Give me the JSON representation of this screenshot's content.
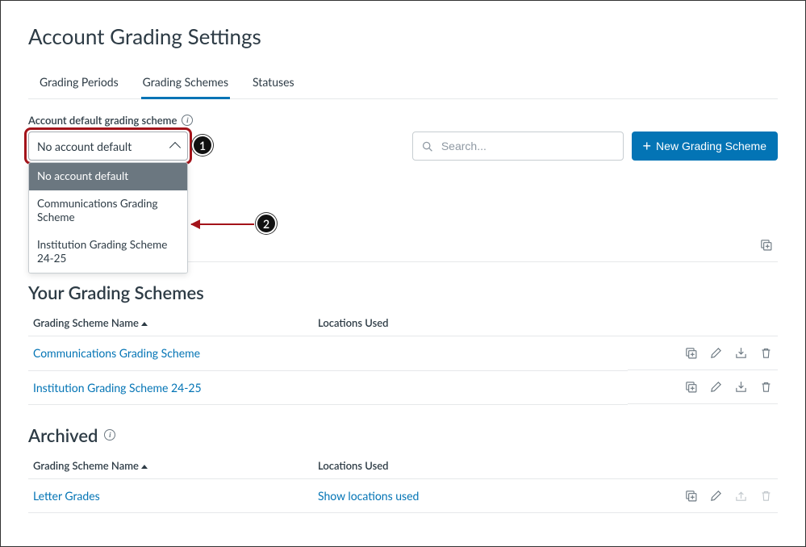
{
  "page_title": "Account Grading Settings",
  "tabs": [
    {
      "label": "Grading Periods",
      "active": false
    },
    {
      "label": "Grading Schemes",
      "active": true
    },
    {
      "label": "Statuses",
      "active": false
    }
  ],
  "field_label": "Account default grading scheme",
  "dropdown": {
    "selected": "No account default",
    "options": [
      "No account default",
      "Communications Grading Scheme",
      "Institution Grading Scheme 24-25"
    ]
  },
  "search_placeholder": "Search...",
  "new_scheme_btn": "New Grading Scheme",
  "callouts": {
    "c1": "1",
    "c2": "2"
  },
  "section_your": "Your Grading Schemes",
  "section_archived": "Archived",
  "col_name": "Grading Scheme Name",
  "col_locations": "Locations Used",
  "your_rows": [
    {
      "name": "Communications Grading Scheme",
      "locations": ""
    },
    {
      "name": "Institution Grading Scheme 24-25",
      "locations": ""
    }
  ],
  "archived_rows": [
    {
      "name": "Letter Grades",
      "locations": "Show locations used"
    }
  ]
}
